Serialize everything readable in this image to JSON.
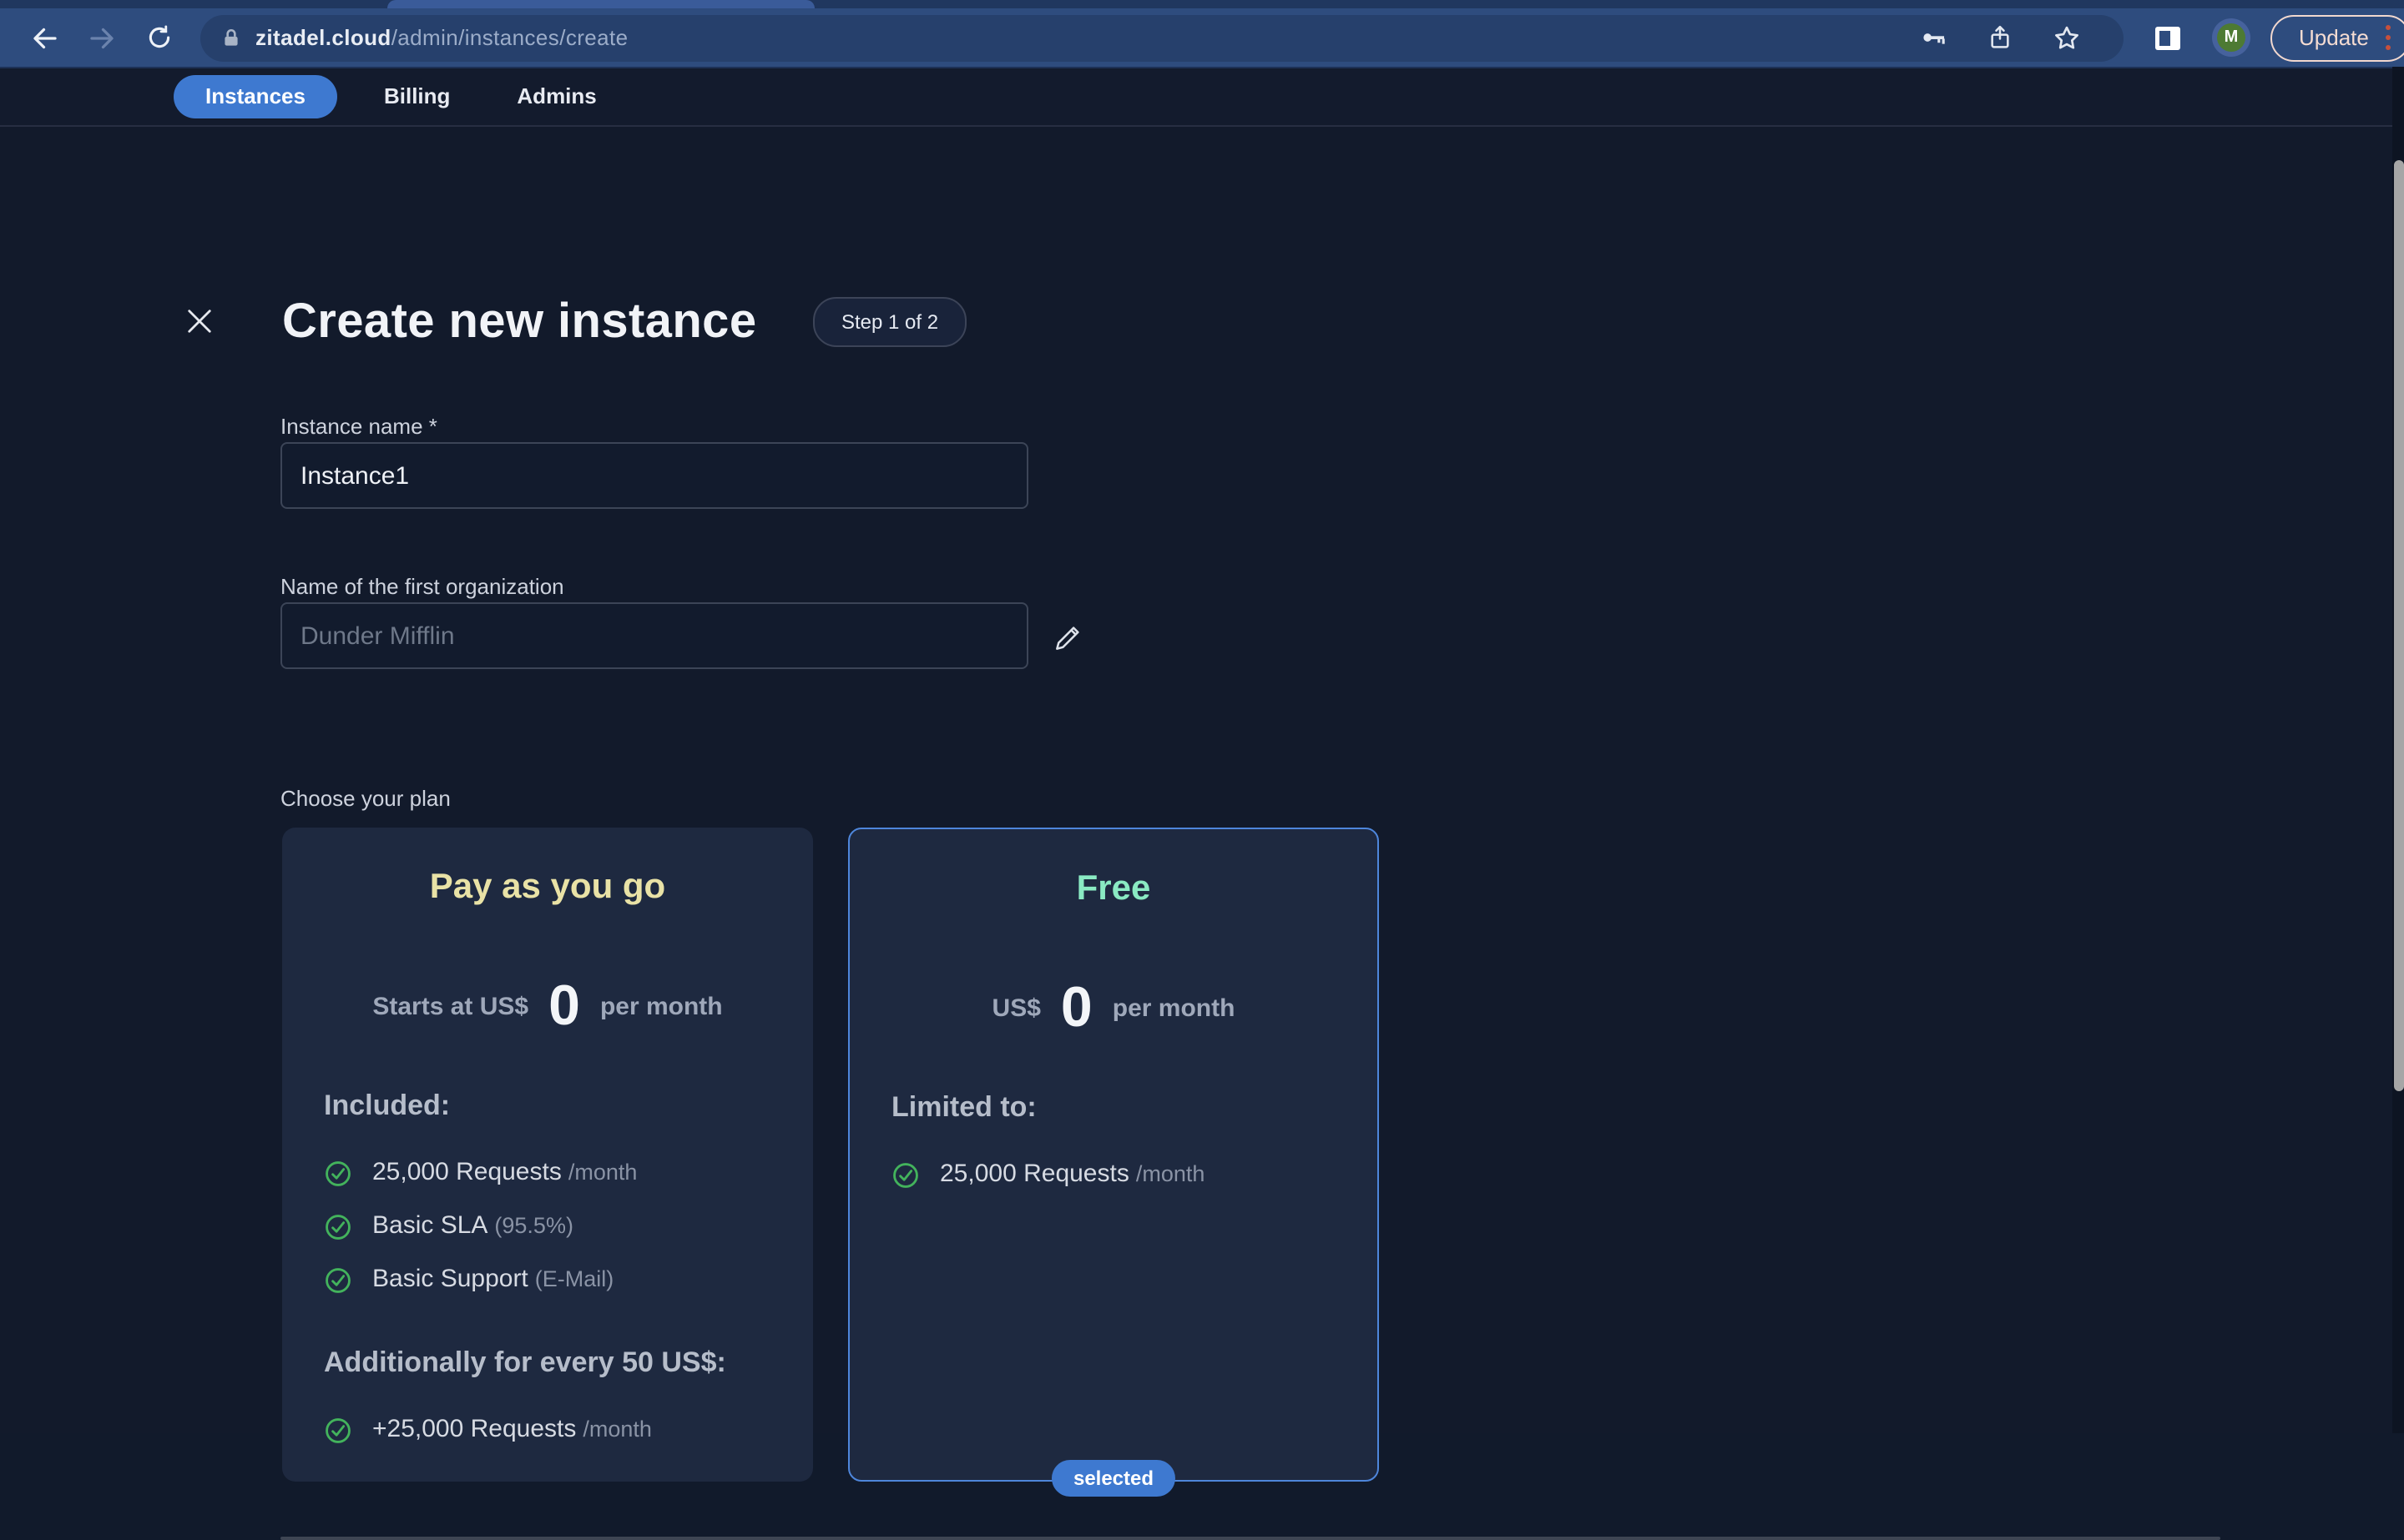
{
  "browser": {
    "url": {
      "domain": "zitadel.cloud",
      "path": "/admin/instances/create"
    },
    "update_button_label": "Update",
    "avatar_letter": "M"
  },
  "nav": {
    "tabs": [
      {
        "label": "Instances",
        "active": true
      },
      {
        "label": "Billing",
        "active": false
      },
      {
        "label": "Admins",
        "active": false
      }
    ]
  },
  "page": {
    "title": "Create new instance",
    "step_badge": "Step 1 of 2",
    "form": {
      "instance_name": {
        "label": "Instance name *",
        "value": "Instance1"
      },
      "organization": {
        "label": "Name of the first organization",
        "placeholder": "Dunder Mifflin"
      }
    },
    "choose_plan_label": "Choose your plan",
    "plans": [
      {
        "title": "Pay as you go",
        "price_prefix": "Starts at US$",
        "price": "0",
        "price_suffix": "per month",
        "sections": [
          {
            "header": "Included:",
            "items": [
              {
                "text": "25,000 Requests",
                "note": "/month"
              },
              {
                "text": "Basic SLA",
                "note": "(95.5%)"
              },
              {
                "text": "Basic Support",
                "note": "(E-Mail)"
              }
            ]
          },
          {
            "header": "Additionally for every 50 US$:",
            "items": [
              {
                "text": "+25,000 Requests",
                "note": "/month"
              }
            ]
          }
        ]
      },
      {
        "title": "Free",
        "price_prefix": "US$",
        "price": "0",
        "price_suffix": "per month",
        "sections": [
          {
            "header": "Limited to:",
            "items": [
              {
                "text": "25,000 Requests",
                "note": "/month"
              }
            ]
          }
        ],
        "selected_badge": "selected"
      }
    ]
  },
  "colors": {
    "accent_blue": "#3e79d0",
    "free_card_border": "#4e86db",
    "check_green": "#43b35c",
    "payg_title": "#e9e2a6",
    "free_title": "#8aeac3",
    "update_button": "#f5dcd2",
    "avatar_green": "#4d7a33"
  }
}
